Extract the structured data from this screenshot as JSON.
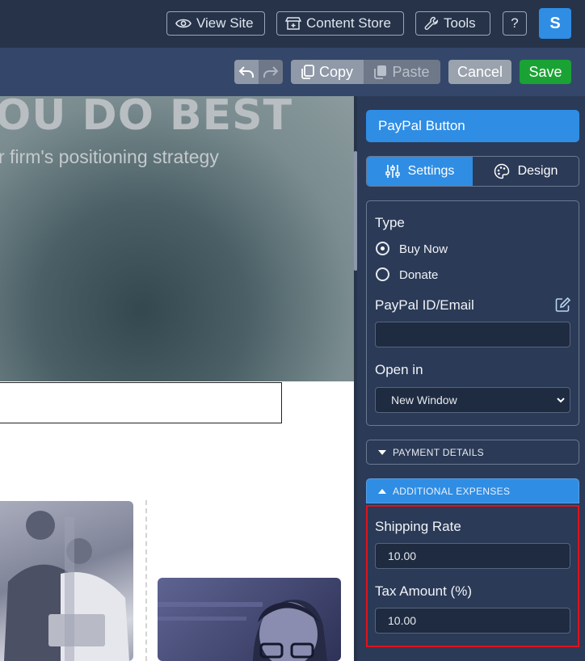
{
  "topbar": {
    "view_site": "View Site",
    "content_store": "Content Store",
    "tools": "Tools",
    "help": "?",
    "avatar_letter": "S"
  },
  "toolbar": {
    "copy": "Copy",
    "paste": "Paste",
    "cancel": "Cancel",
    "save": "Save"
  },
  "canvas": {
    "hero_title": "OU DO BEST",
    "hero_subtitle": "r firm's positioning strategy"
  },
  "panel": {
    "title": "PayPal Button",
    "tabs": [
      {
        "label": "Settings",
        "icon": "sliders-icon",
        "active": true
      },
      {
        "label": "Design",
        "icon": "palette-icon",
        "active": false
      }
    ],
    "type_label": "Type",
    "type_options": [
      {
        "label": "Buy Now",
        "selected": true
      },
      {
        "label": "Donate",
        "selected": false
      }
    ],
    "paypal_id_label": "PayPal ID/Email",
    "paypal_id_value": "",
    "open_in_label": "Open in",
    "open_in_value": "New Window",
    "payment_details": "PAYMENT DETAILS",
    "additional_expenses": "ADDITIONAL EXPENSES",
    "shipping_rate_label": "Shipping Rate",
    "shipping_rate_value": "10.00",
    "tax_amount_label": "Tax Amount (%)",
    "tax_amount_value": "10.00"
  },
  "colors": {
    "accent": "#2f8de4",
    "save": "#1aa334",
    "highlight": "#e0121c",
    "panel_bg": "#2b3a56"
  }
}
